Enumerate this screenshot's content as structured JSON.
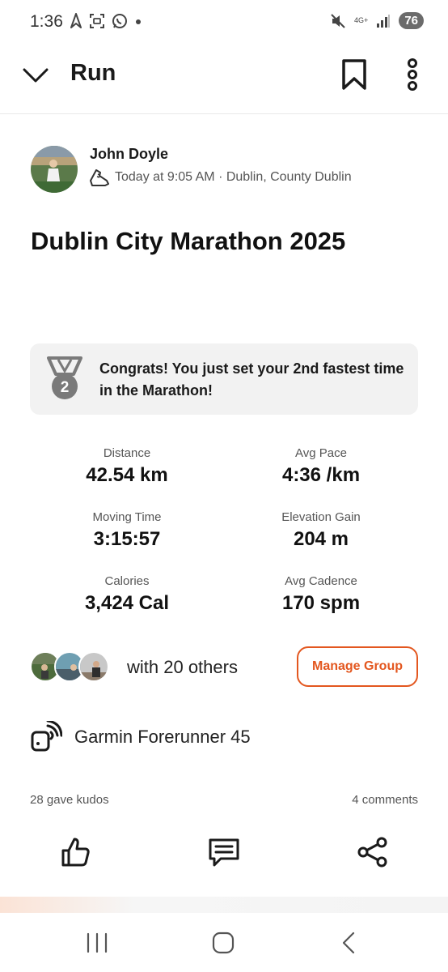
{
  "status_bar": {
    "time": "1:36",
    "network": "4G+",
    "battery": "76",
    "icons": [
      "navigation-icon",
      "screenshot-icon",
      "whatsapp-icon",
      "dot-icon",
      "mute-icon",
      "signal-icon"
    ]
  },
  "header": {
    "title": "Run",
    "icons": [
      "chevron-down-icon",
      "bookmark-icon",
      "more-vertical-icon"
    ]
  },
  "athlete": {
    "name": "John Doyle",
    "meta": "Today at 9:05 AM · Dublin, County Dublin"
  },
  "activity": {
    "title": "Dublin City Marathon 2025"
  },
  "achievement": {
    "rank": "2",
    "text": "Congrats! You just set your 2nd fastest time in the Marathon!"
  },
  "stats": [
    {
      "label": "Distance",
      "value": "42.54 km"
    },
    {
      "label": "Avg Pace",
      "value": "4:36 /km"
    },
    {
      "label": "Moving Time",
      "value": "3:15:57"
    },
    {
      "label": "Elevation Gain",
      "value": "204 m"
    },
    {
      "label": "Calories",
      "value": "3,424 Cal"
    },
    {
      "label": "Avg Cadence",
      "value": "170 spm"
    }
  ],
  "group": {
    "text": "with 20 others",
    "button": "Manage Group"
  },
  "device": {
    "name": "Garmin Forerunner 45"
  },
  "social": {
    "kudos": "28 gave kudos",
    "comments": "4 comments"
  },
  "colors": {
    "accent": "#e3571f",
    "card_bg": "#f2f2f2",
    "medal": "#7a7a7a"
  }
}
